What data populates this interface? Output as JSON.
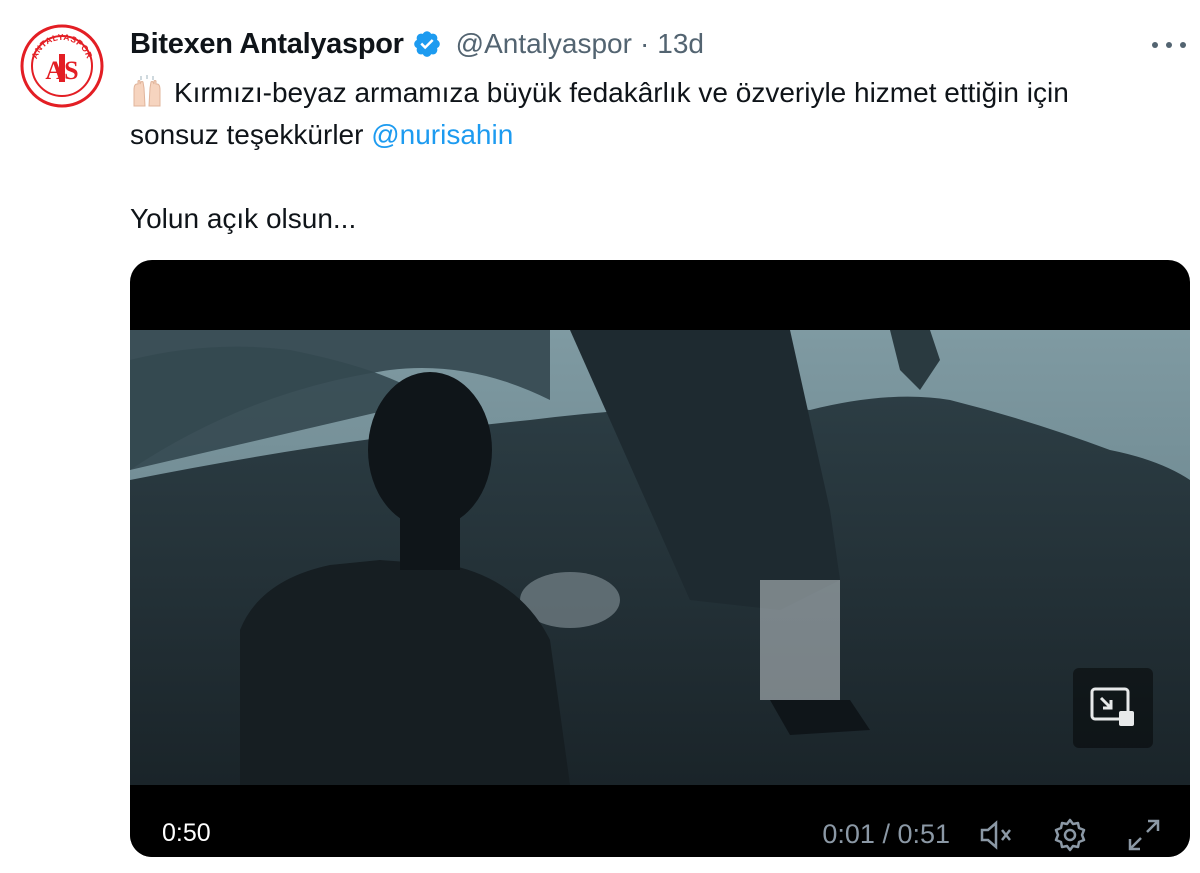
{
  "tweet": {
    "author": {
      "display_name": "Bitexen Antalyaspor",
      "handle": "@Antalyaspor",
      "avatar_text": "ANTALYASPOR",
      "avatar_initials": "AS",
      "verified": true
    },
    "separator": "·",
    "time": "13d",
    "more_icon": "more-horizontal-icon",
    "text": {
      "line1": "Kırmızı-beyaz armamıza büyük fedakârlık ve özveriyle hizmet ettiğin için",
      "line2": "sonsuz teşekkürler",
      "mention": "@nurisahin",
      "line3": "Yolun açık olsun...",
      "emoji": "raising-hands-emoji"
    },
    "media": {
      "type": "video",
      "elapsed_overlay": "0:50",
      "time_display": "0:01 / 0:51",
      "progress": 0.02,
      "controls": [
        "mute-icon",
        "settings-gear-icon",
        "fullscreen-icon"
      ],
      "overlay_button": "picture-in-picture-icon"
    }
  },
  "colors": {
    "text": "#0f1419",
    "secondary": "#536471",
    "mention": "#1d9bf0",
    "verified": "#1d9bf0",
    "brand_red": "#e31e24"
  }
}
